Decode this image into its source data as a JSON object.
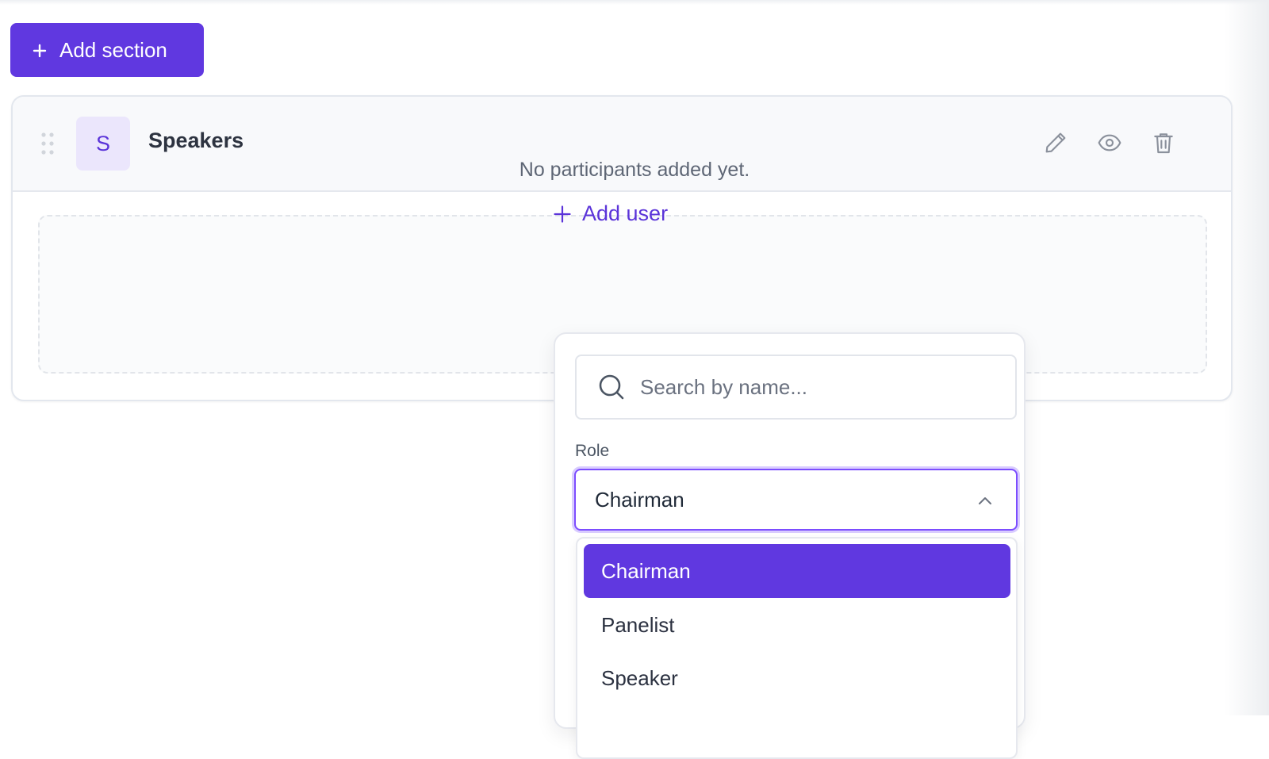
{
  "toolbar": {
    "add_section_label": "Add section"
  },
  "section": {
    "avatar_letter": "S",
    "title": "Speakers",
    "empty_message": "No participants added yet.",
    "add_user_label": "Add user"
  },
  "add_user_popover": {
    "search": {
      "placeholder": "Search by name...",
      "value": ""
    },
    "role": {
      "label": "Role",
      "selected": "Chairman",
      "options": [
        "Chairman",
        "Panelist",
        "Speaker"
      ]
    }
  },
  "icons": {
    "drag": "drag-handle-icon",
    "edit": "pencil-icon",
    "view": "eye-icon",
    "delete": "trash-icon",
    "search": "search-icon",
    "chevron": "chevron-up-icon",
    "plus": "plus-icon"
  },
  "colors": {
    "primary": "#6038e0",
    "avatar_bg": "#ebe6fc",
    "focus_ring": "#7c4dff"
  }
}
